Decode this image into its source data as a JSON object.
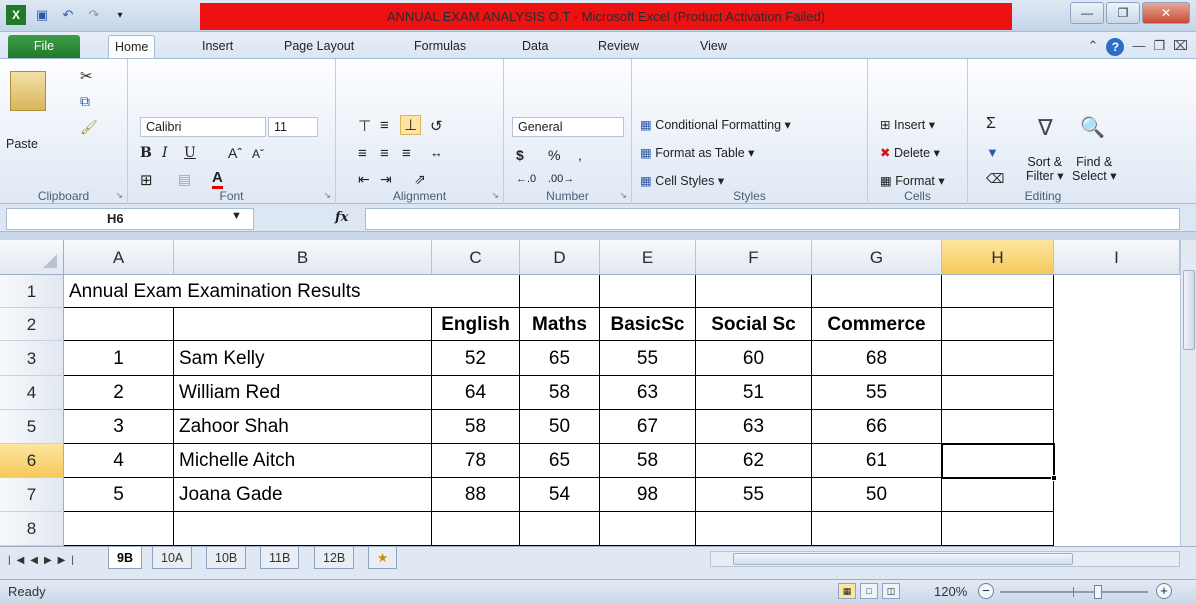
{
  "window": {
    "title": "ANNUAL EXAM ANALYSIS O.T  -  Microsoft Excel (Product Activation Failed)",
    "accent": "#ee1111"
  },
  "menu": {
    "tabs": [
      "File",
      "Home",
      "Insert",
      "Page Layout",
      "Formulas",
      "Data",
      "Review",
      "View"
    ]
  },
  "ribbon": {
    "clipboard": {
      "label": "Clipboard",
      "paste": "Paste"
    },
    "font": {
      "label": "Font",
      "name": "Calibri",
      "size": "11"
    },
    "alignment": {
      "label": "Alignment"
    },
    "number": {
      "label": "Number",
      "format": "General",
      "currency": "$",
      "percent": "%"
    },
    "styles": {
      "label": "Styles",
      "conditional": "Conditional Formatting",
      "table": "Format as Table",
      "cell": "Cell Styles"
    },
    "cells": {
      "label": "Cells",
      "insert": "Insert",
      "delete": "Delete",
      "format": "Format"
    },
    "editing": {
      "label": "Editing",
      "sort1": "Sort &",
      "sort2": "Filter",
      "find1": "Find &",
      "find2": "Select"
    }
  },
  "formula_bar": {
    "name_box": "H6",
    "fx": "fx",
    "value": ""
  },
  "grid": {
    "columns": [
      "A",
      "B",
      "C",
      "D",
      "E",
      "F",
      "G",
      "H",
      "I"
    ],
    "rows": [
      "1",
      "2",
      "3",
      "4",
      "5",
      "6",
      "7",
      "8"
    ],
    "title": "Annual Exam Examination Results",
    "headers": [
      "English",
      "Maths",
      "BasicSc",
      "Social Sc",
      "Commerce"
    ],
    "records": [
      {
        "no": "1",
        "name": "Sam Kelly",
        "scores": [
          "52",
          "65",
          "55",
          "60",
          "68"
        ]
      },
      {
        "no": "2",
        "name": "William Red",
        "scores": [
          "64",
          "58",
          "63",
          "51",
          "55"
        ]
      },
      {
        "no": "3",
        "name": "Zahoor Shah",
        "scores": [
          "58",
          "50",
          "67",
          "63",
          "66"
        ]
      },
      {
        "no": "4",
        "name": "Michelle Aitch",
        "scores": [
          "78",
          "65",
          "58",
          "62",
          "61"
        ]
      },
      {
        "no": "5",
        "name": "Joana Gade",
        "scores": [
          "88",
          "54",
          "98",
          "55",
          "50"
        ]
      }
    ],
    "active_cell": "H6"
  },
  "sheets": [
    "9B",
    "10A",
    "10B",
    "11B",
    "12B"
  ],
  "status": {
    "ready": "Ready",
    "zoom": "120%"
  }
}
